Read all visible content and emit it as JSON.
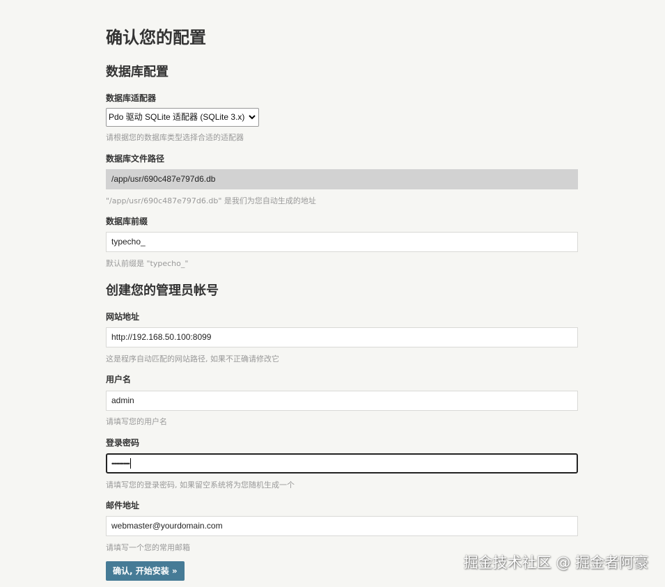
{
  "page_title": "确认您的配置",
  "db_section": {
    "title": "数据库配置",
    "adapter": {
      "label": "数据库适配器",
      "selected": "Pdo 驱动 SQLite 适配器 (SQLite 3.x)",
      "hint": "请根据您的数据库类型选择合适的适配器"
    },
    "file_path": {
      "label": "数据库文件路径",
      "value": "/app/usr/690c487e797d6.db",
      "hint": "\"/app/usr/690c487e797d6.db\" 是我们为您自动生成的地址"
    },
    "prefix": {
      "label": "数据库前缀",
      "value": "typecho_",
      "hint": "默认前缀是 \"typecho_\""
    }
  },
  "admin_section": {
    "title": "创建您的管理员帐号",
    "site_url": {
      "label": "网站地址",
      "value": "http://192.168.50.100:8099",
      "hint": "这是程序自动匹配的网站路径, 如果不正确请修改它"
    },
    "username": {
      "label": "用户名",
      "value": "admin",
      "hint": "请填写您的用户名"
    },
    "password": {
      "label": "登录密码",
      "value": "••••••••••••",
      "hint": "请填写您的登录密码, 如果留空系统将为您随机生成一个"
    },
    "email": {
      "label": "邮件地址",
      "value": "webmaster@yourdomain.com",
      "hint": "请填写一个您的常用邮箱"
    }
  },
  "submit_label": "确认, 开始安装 »",
  "watermark": "掘金技术社区 @ 掘金者阿豪",
  "colors": {
    "background": "#f6f6f3",
    "button": "#467b96",
    "readonly_field": "#d2d2d2",
    "hint_text": "#999999"
  },
  "icons": {
    "select_arrow": "chevron-down-icon"
  }
}
